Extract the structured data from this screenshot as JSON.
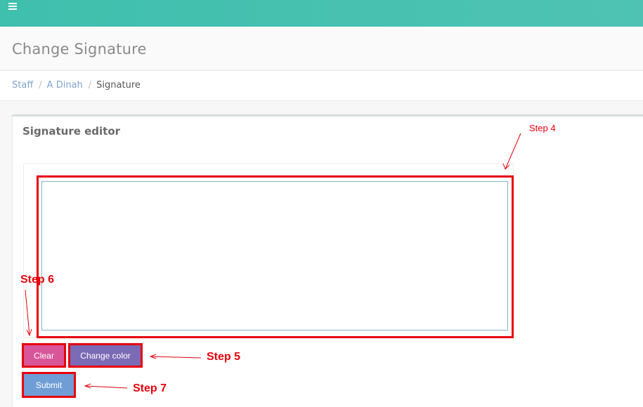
{
  "page": {
    "title": "Change Signature"
  },
  "breadcrumb": {
    "items": [
      "Staff",
      "A Dinah"
    ],
    "current": "Signature",
    "separator": "/"
  },
  "panel": {
    "title": "Signature editor"
  },
  "buttons": {
    "clear_label": "Clear",
    "change_color_label": "Change color",
    "submit_label": "Submit"
  },
  "annotations": {
    "step4": "Step 4",
    "step5": "Step 5",
    "step6": "Step 6",
    "step7": "Step 7",
    "color": "#e8000b"
  },
  "icons": {
    "menu": "hamburger-menu-icon"
  },
  "colors": {
    "topbar": "#47c1b0",
    "clear_button": "#d9559a",
    "change_color_button": "#7b6ab5",
    "submit_button": "#6f9ed6",
    "link": "#7ea4c9"
  }
}
